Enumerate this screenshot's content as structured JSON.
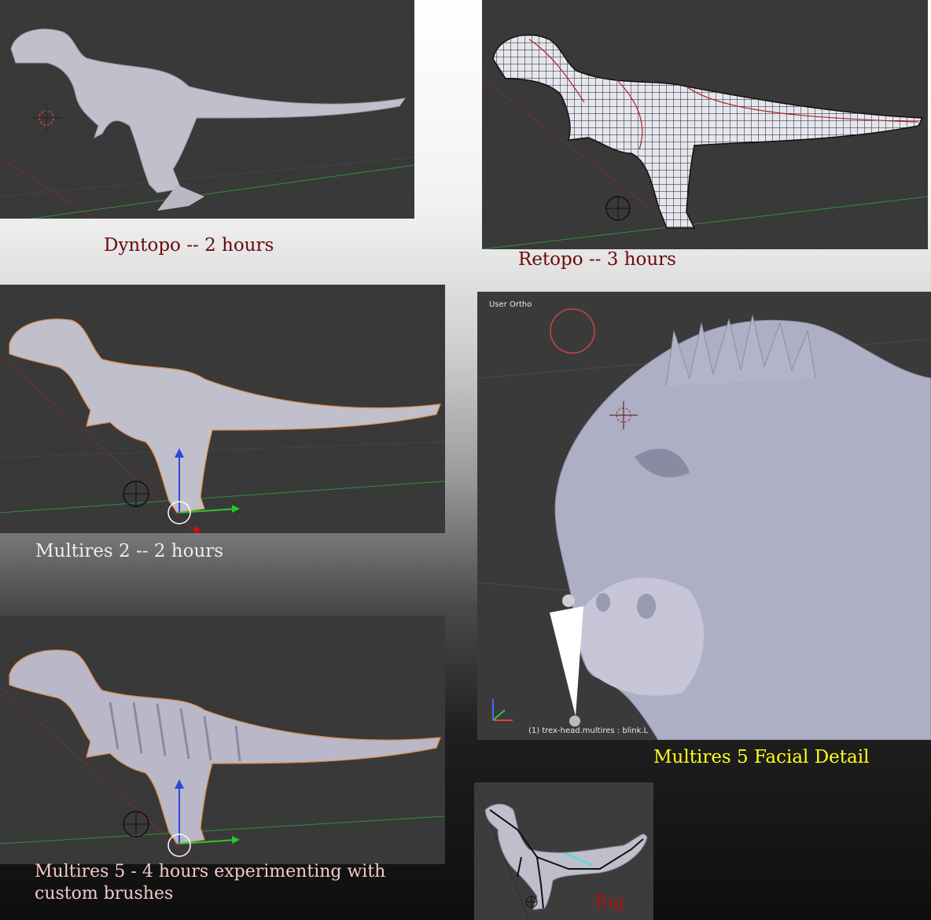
{
  "captions": {
    "dyntopo": "Dyntopo -- 2 hours",
    "retopo": "Retopo -- 3 hours",
    "multires2": "Multires 2  -- 2 hours",
    "multires5_line1": "Multires 5  - 4 hours experimenting with",
    "multires5_line2": "custom brushes",
    "facial": "Multires 5 Facial Detail",
    "rig": "Rig"
  },
  "viewport": {
    "view_label": "User Ortho",
    "object_label": "(1) trex-head.multires : blink.L"
  },
  "colors": {
    "caption_dark_red": "#6b0a0a",
    "caption_light": "#e8e8e8",
    "caption_pink": "#f4c9c9",
    "caption_yellow": "#ffff1a",
    "caption_rig_red": "#b01010",
    "viewport_bg": "#393939",
    "mesh": "#c2c2d2"
  }
}
